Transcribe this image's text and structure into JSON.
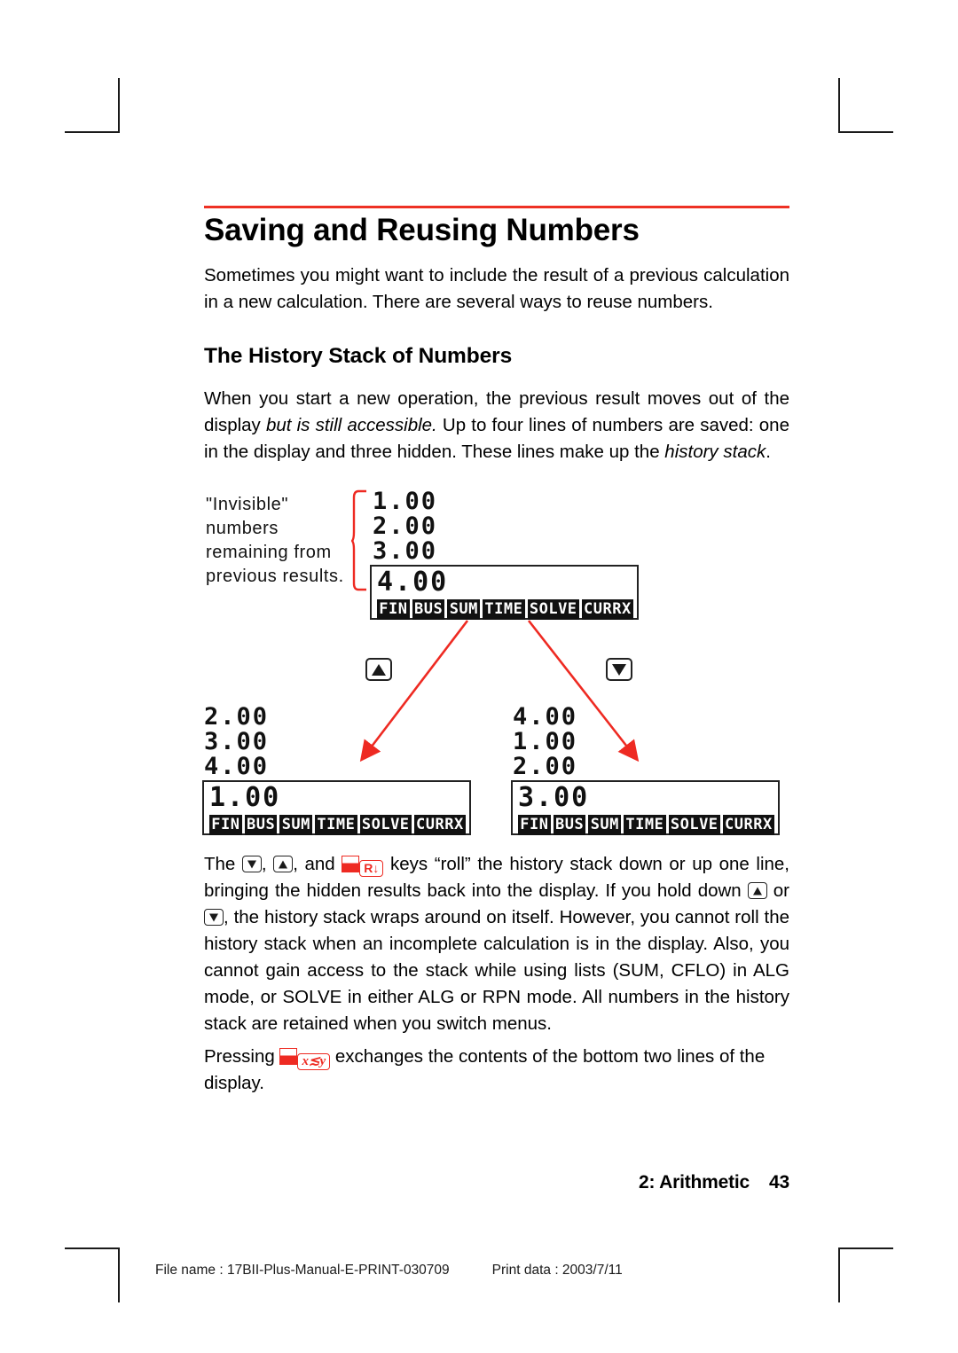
{
  "page": {
    "accent_color": "#ee3124",
    "key_red": "#ee2a22"
  },
  "heading": {
    "title": "Saving and Reusing Numbers",
    "subtitle": "The History Stack of Numbers"
  },
  "intro_paragraph": "Sometimes you might want to include the result of a previous calculation in a new calculation. There are several ways to reuse numbers.",
  "stack_paragraph": {
    "part1": "When you start a new operation, the previous result moves out of the display ",
    "italic1": "but is still accessible.",
    "part2": " Up to four lines of numbers are saved: one in the display and three hidden. These lines make up the ",
    "italic2": "history stack",
    "part3": "."
  },
  "diagram": {
    "annotation": {
      "line1": "\"Invisible\"",
      "line2": "numbers",
      "line3": "remaining from",
      "line4": "previous results."
    },
    "menu_labels": [
      "FIN",
      "BUS",
      "SUM",
      "TIME",
      "SOLVE",
      "CURRX"
    ],
    "displays": [
      {
        "id": "top-display",
        "hidden_lines": [
          "1.00",
          "2.00",
          "3.00"
        ],
        "display_line": "4.00"
      },
      {
        "id": "left-display",
        "hidden_lines": [
          "2.00",
          "3.00",
          "4.00"
        ],
        "display_line": "1.00"
      },
      {
        "id": "right-display",
        "hidden_lines": [
          "4.00",
          "1.00",
          "2.00"
        ],
        "display_line": "3.00"
      }
    ],
    "keys": {
      "up": "up-arrow-key",
      "down": "down-arrow-key"
    }
  },
  "roll_paragraph": {
    "p1": "The ",
    "p2": ", ",
    "p3": ", and ",
    "roll_key_label": "R↓",
    "p4": " keys “roll” the history stack down or up one line, bringing the hidden results back into the display. If you hold down ",
    "p5": " or ",
    "p6": ", the history stack wraps around on itself. However, you cannot roll the history stack when an incomplete calculation is in the display. Also, you cannot gain access to the stack while using lists (SUM, CFLO) in ALG mode, or SOLVE in either ALG or RPN mode. All numbers in the history stack are retained when you switch menus."
  },
  "swap_paragraph": {
    "p1": "Pressing ",
    "swap_key_label": "x≲y",
    "p2": " exchanges the contents of the bottom two lines of the display."
  },
  "footer": {
    "chapter": "2: Arithmetic",
    "page_number": "43",
    "file_name": "File name : 17BII-Plus-Manual-E-PRINT-030709",
    "print_data": "Print data : 2003/7/11"
  }
}
